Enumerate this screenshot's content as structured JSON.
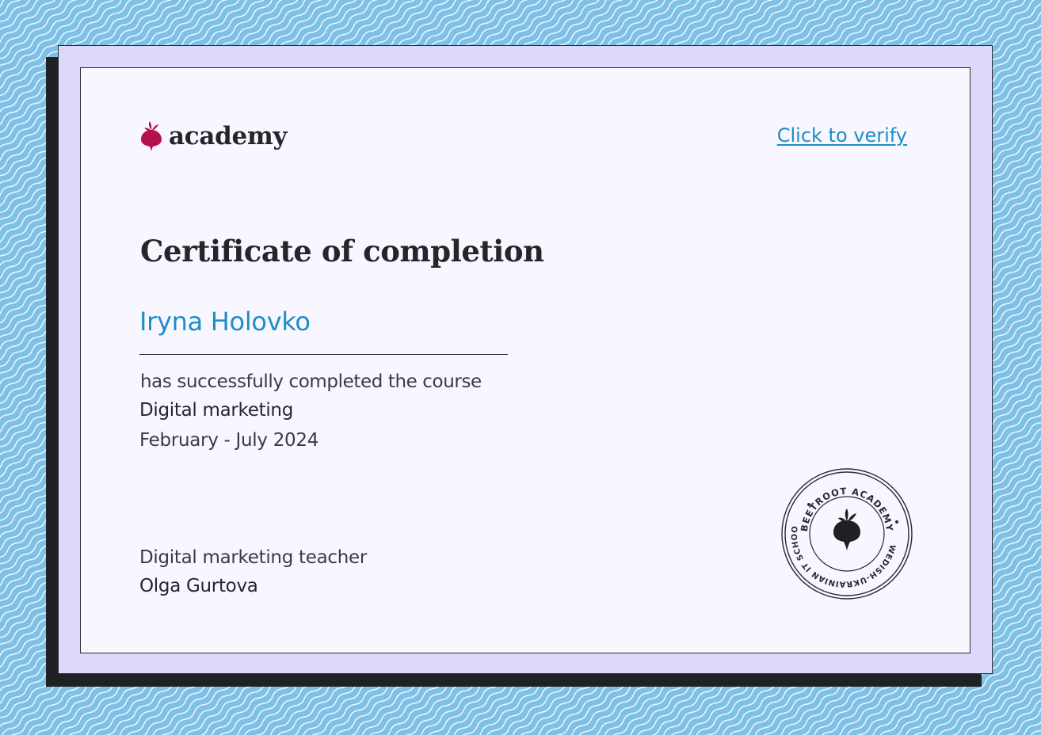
{
  "header": {
    "logo_text": "academy",
    "verify_link": "Click to verify"
  },
  "certificate": {
    "title": "Certificate of completion",
    "recipient_name": "Iryna Holovko",
    "completed_text": "has successfully completed the course",
    "course_name": "Digital marketing",
    "course_dates": "February - July 2024"
  },
  "signature": {
    "teacher_role": "Digital marketing teacher",
    "teacher_name": "Olga Gurtova"
  },
  "seal": {
    "top_text": "BEETROOT ACADEMY",
    "bottom_text": "SWEDISH-UKRAINIAN IT SCHOOL",
    "icon": "beetroot-icon"
  },
  "colors": {
    "background": "#7ec0e6",
    "frame": "#ded9fb",
    "card": "#f8f6ff",
    "accent_blue": "#1d8ec6",
    "brand_beet": "#b3124a",
    "text_dark": "#25262a"
  }
}
